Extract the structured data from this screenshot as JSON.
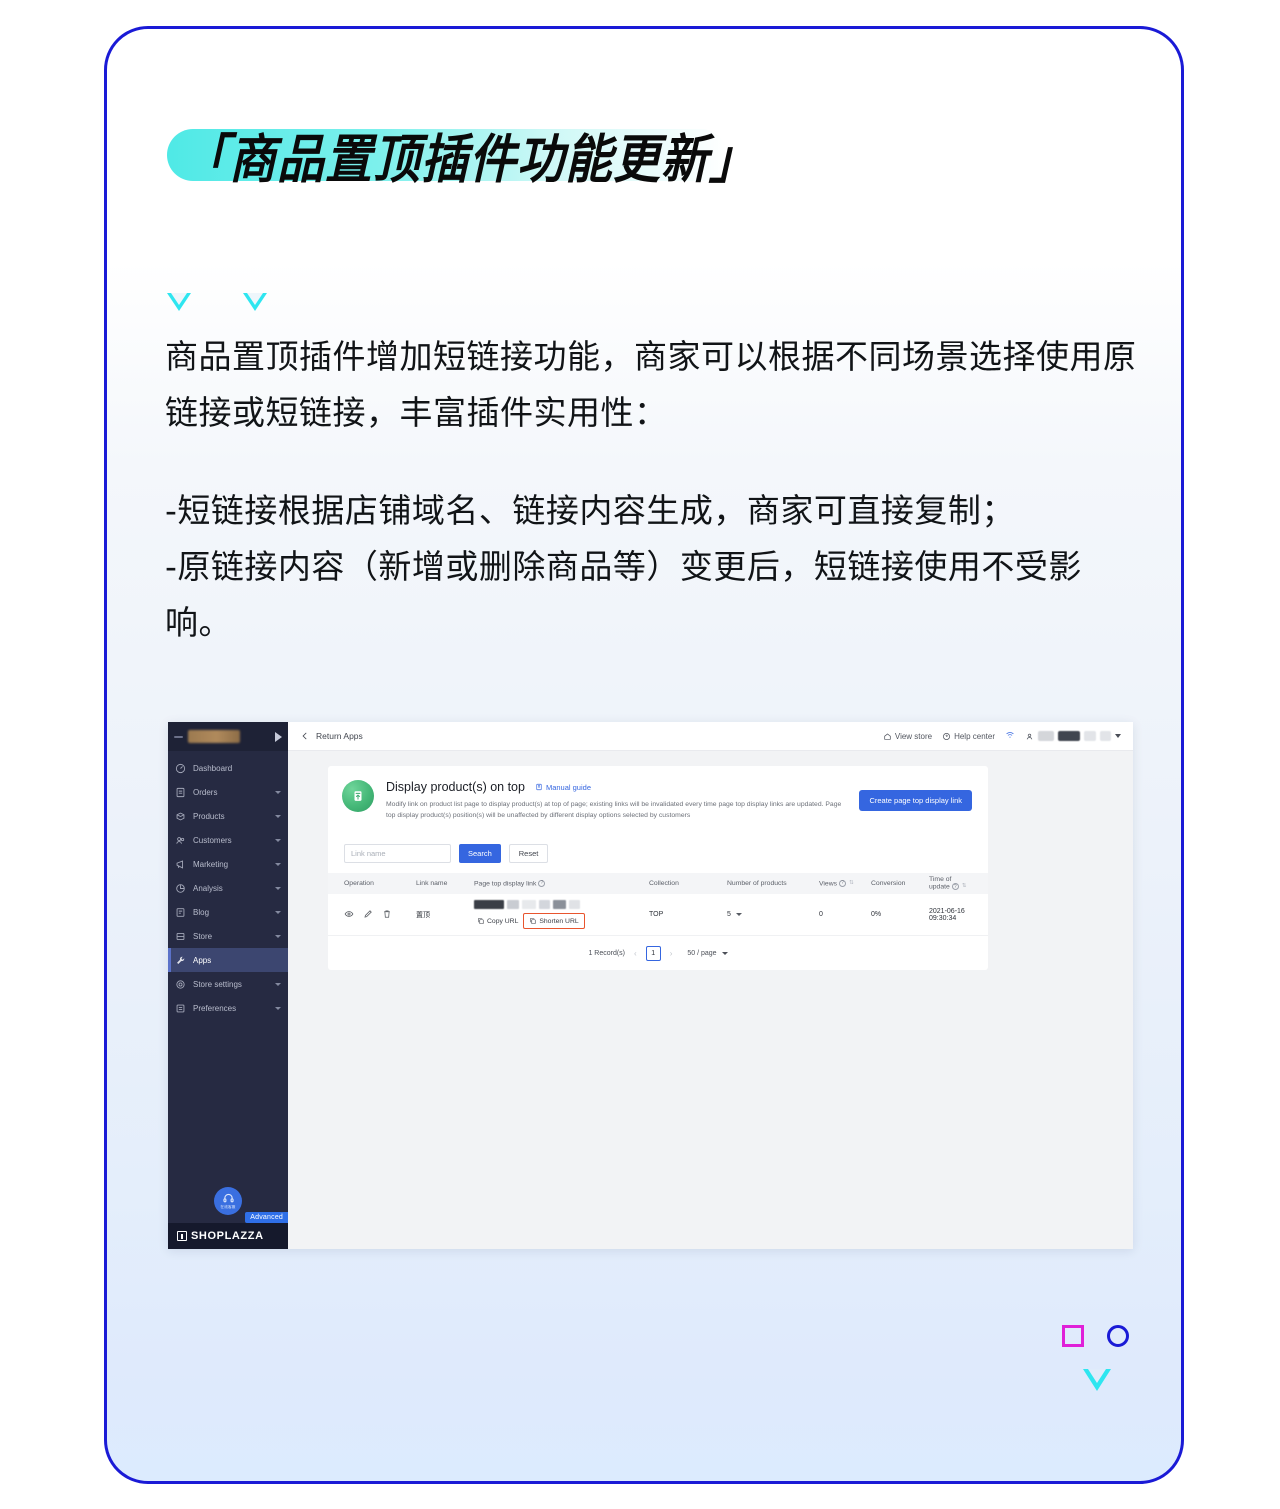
{
  "poster": {
    "title": "「商品置顶插件功能更新」",
    "paragraph1": "商品置顶插件增加短链接功能，商家可以根据不同场景选择使用原链接或短链接，丰富插件实用性：",
    "paragraph2_line1": "-短链接根据店铺域名、链接内容生成，商家可直接复制；",
    "paragraph2_line2": "-原链接内容（新增或删除商品等）变更后，短链接使用不受影响。",
    "colors": {
      "border": "#1a1ad6",
      "highlight": "#4fe9e6",
      "triangle": "#2ee6f0",
      "square": "#e020d8",
      "circle": "#1a1ad6"
    }
  },
  "app": {
    "sidebar": {
      "store_name_redacted": "",
      "items": [
        {
          "label": "Dashboard",
          "icon": "dashboard-icon",
          "chevron": false,
          "active": false
        },
        {
          "label": "Orders",
          "icon": "orders-icon",
          "chevron": true,
          "active": false
        },
        {
          "label": "Products",
          "icon": "products-icon",
          "chevron": true,
          "active": false
        },
        {
          "label": "Customers",
          "icon": "customers-icon",
          "chevron": true,
          "active": false
        },
        {
          "label": "Marketing",
          "icon": "marketing-icon",
          "chevron": true,
          "active": false
        },
        {
          "label": "Analysis",
          "icon": "analysis-icon",
          "chevron": true,
          "active": false
        },
        {
          "label": "Blog",
          "icon": "blog-icon",
          "chevron": true,
          "active": false
        },
        {
          "label": "Store",
          "icon": "store-icon",
          "chevron": true,
          "active": false
        },
        {
          "label": "Apps",
          "icon": "apps-wrench-icon",
          "chevron": false,
          "active": true
        },
        {
          "label": "Store settings",
          "icon": "gear-icon",
          "chevron": true,
          "active": false
        },
        {
          "label": "Preferences",
          "icon": "preferences-icon",
          "chevron": true,
          "active": false
        }
      ],
      "support_label": "在线客服",
      "advanced_badge": "Advanced",
      "brand": "SHOPLAZZA"
    },
    "topbar": {
      "back_label": "Return Apps",
      "view_store": "View store",
      "help_center": "Help center"
    },
    "page_header": {
      "title": "Display product(s) on top",
      "manual_guide": "Manual guide",
      "description": "Modify link on product list page to display product(s) at top of page; existing links will be invalidated every time page top display links are updated. Page top display product(s) position(s) will be unaffected by different display options selected by customers",
      "cta": "Create page top display link"
    },
    "filter": {
      "placeholder": "Link name",
      "search": "Search",
      "reset": "Reset"
    },
    "table": {
      "columns": [
        "Operation",
        "Link name",
        "Page top display link",
        "Collection",
        "Number of products",
        "Views",
        "Conversion",
        "Time of update"
      ],
      "row": {
        "link_name": "置顶",
        "copy_url": "Copy URL",
        "shorten_url": "Shorten URL",
        "collection": "TOP",
        "number_of_products": "5",
        "views": "0",
        "conversion": "0%",
        "time_of_update": "2021-06-16 09:30:34"
      }
    },
    "pagination": {
      "records": "1 Record(s)",
      "page": "1",
      "page_size": "50 / page"
    }
  }
}
